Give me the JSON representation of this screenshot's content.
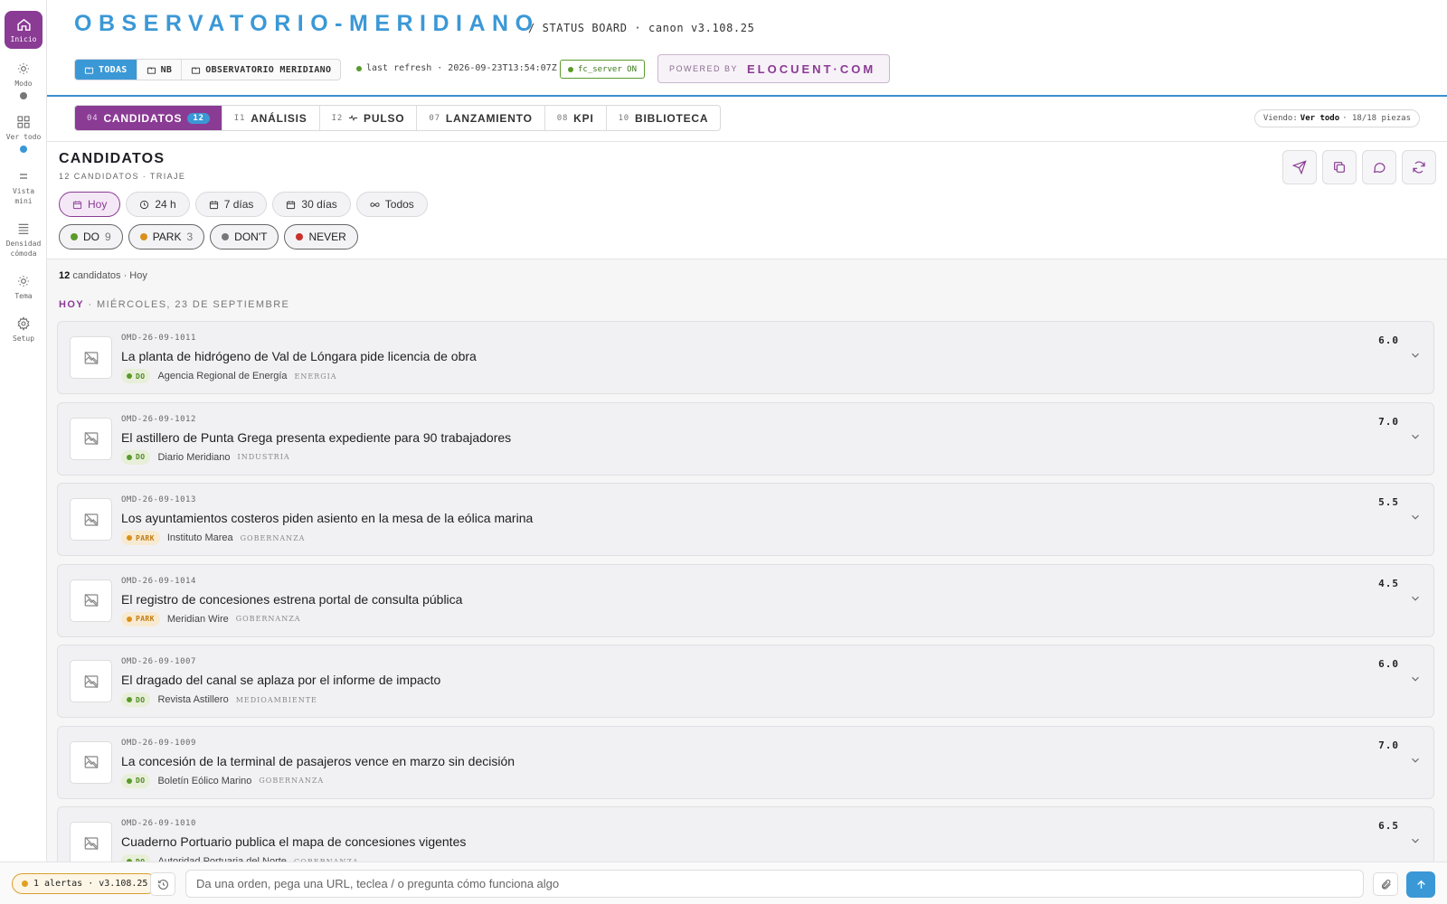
{
  "rail": {
    "home": "Inicio",
    "items": [
      {
        "label": "Modo",
        "icon": "sun-icon",
        "dot": "#777777"
      },
      {
        "label": "Ver todo",
        "icon": "grid-icon",
        "dot": "#3b98d6"
      },
      {
        "label": "Vista\nmini",
        "icon": "equals-icon",
        "dot": null
      },
      {
        "label": "Densidad\ncómoda",
        "icon": "lines-icon",
        "dot": null
      },
      {
        "label": "Tema",
        "icon": "sun-icon",
        "dot": null
      },
      {
        "label": "Setup",
        "icon": "gear-icon",
        "dot": null
      }
    ]
  },
  "header": {
    "brand": "OBSERVATORIO-MERIDIANO",
    "subtitle": "/ STATUS BOARD · canon v3.108.25",
    "filters": [
      "TODAS",
      "NB",
      "OBSERVATORIO MERIDIANO"
    ],
    "refresh": "last refresh · 2026-09-23T13:54:07Z",
    "server": "fc_server ON",
    "powered_by": "POWERED BY",
    "powered_brand": "ELOCUENT·COM"
  },
  "tabs": [
    {
      "num": "04",
      "label": "CANDIDATOS",
      "badge": "12"
    },
    {
      "num": "I1",
      "label": "ANÁLISIS"
    },
    {
      "num": "I2",
      "label": "PULSO"
    },
    {
      "num": "07",
      "label": "LANZAMIENTO"
    },
    {
      "num": "08",
      "label": "KPI"
    },
    {
      "num": "10",
      "label": "BIBLIOTECA"
    }
  ],
  "viewing": {
    "prefix": "Viendo:",
    "value": "Ver todo",
    "suffix": "· 18/18 piezas"
  },
  "section": {
    "title": "CANDIDATOS",
    "subtitle": "12 CANDIDATOS · TRIAJE",
    "time_chips": [
      "Hoy",
      "24 h",
      "7 días",
      "30 días",
      "Todos"
    ],
    "verdicts": [
      {
        "label": "DO",
        "count": "9",
        "color": "#5a9a2c"
      },
      {
        "label": "PARK",
        "count": "3",
        "color": "#d9901c"
      },
      {
        "label": "DON'T",
        "count": "",
        "color": "#777777"
      },
      {
        "label": "NEVER",
        "count": "",
        "color": "#c9302c"
      }
    ]
  },
  "list": {
    "count": "12",
    "count_suffix": "candidatos · Hoy",
    "day_label": "HOY",
    "day_rest": "· MIÉRCOLES, 23 DE SEPTIEMBRE",
    "items": [
      {
        "id": "OMD-26-09-1011",
        "title": "La planta de hidrógeno de Val de Lóngara pide licencia de obra",
        "verdict": "DO",
        "source": "Agencia Regional de Energía",
        "tag": "ENERGIA",
        "score": "6.0"
      },
      {
        "id": "OMD-26-09-1012",
        "title": "El astillero de Punta Grega presenta expediente para 90 trabajadores",
        "verdict": "DO",
        "source": "Diario Meridiano",
        "tag": "INDUSTRIA",
        "score": "7.0"
      },
      {
        "id": "OMD-26-09-1013",
        "title": "Los ayuntamientos costeros piden asiento en la mesa de la eólica marina",
        "verdict": "PARK",
        "source": "Instituto Marea",
        "tag": "GOBERNANZA",
        "score": "5.5"
      },
      {
        "id": "OMD-26-09-1014",
        "title": "El registro de concesiones estrena portal de consulta pública",
        "verdict": "PARK",
        "source": "Meridian Wire",
        "tag": "GOBERNANZA",
        "score": "4.5"
      },
      {
        "id": "OMD-26-09-1007",
        "title": "El dragado del canal se aplaza por el informe de impacto",
        "verdict": "DO",
        "source": "Revista Astillero",
        "tag": "MEDIOAMBIENTE",
        "score": "6.0"
      },
      {
        "id": "OMD-26-09-1009",
        "title": "La concesión de la terminal de pasajeros vence en marzo sin decisión",
        "verdict": "DO",
        "source": "Boletín Eólico Marino",
        "tag": "GOBERNANZA",
        "score": "7.0"
      },
      {
        "id": "OMD-26-09-1010",
        "title": "Cuaderno Portuario publica el mapa de concesiones vigentes",
        "verdict": "DO",
        "source": "Autoridad Portuaria del Norte",
        "tag": "GOBERNANZA",
        "score": "6.5"
      }
    ]
  },
  "bottom": {
    "alerts": "1 alertas · v3.108.25",
    "placeholder": "Da una orden, pega una URL, teclea / o pregunta cómo funciona algo"
  }
}
